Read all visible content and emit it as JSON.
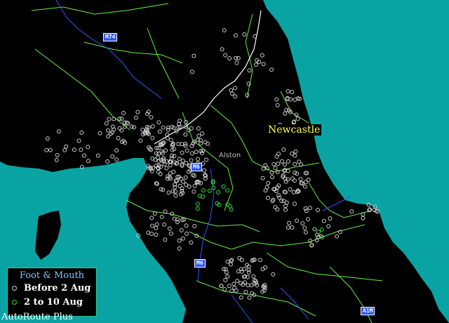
{
  "app": {
    "brand": "AutoRoute Plus"
  },
  "labels": {
    "newcastle": "Newcastle",
    "alston": "Alston"
  },
  "road_shields": [
    "M74",
    "M6",
    "M6",
    "M6",
    "A1M"
  ],
  "legend": {
    "title": "Foot & Mouth",
    "items": [
      {
        "label": "Before 2 Aug",
        "color": "#cccccc"
      },
      {
        "label": "2 to 10 Aug",
        "color": "#33dd33"
      }
    ]
  },
  "colors": {
    "sea": "#0aa3a3",
    "land": "#000000",
    "county_border": "#66ee44",
    "national_border": "#ffffff",
    "rivers": "#3355ff",
    "case_before": "#cccccc",
    "case_after": "#33dd33"
  }
}
